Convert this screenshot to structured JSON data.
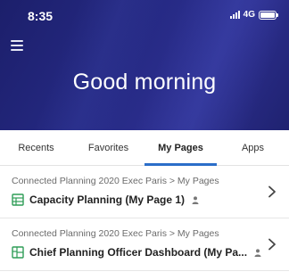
{
  "status_bar": {
    "time": "8:35",
    "network": "4G"
  },
  "header": {
    "greeting": "Good morning"
  },
  "tabs": [
    {
      "label": "Recents",
      "active": false
    },
    {
      "label": "Favorites",
      "active": false
    },
    {
      "label": "My Pages",
      "active": true
    },
    {
      "label": "Apps",
      "active": false
    }
  ],
  "pages": [
    {
      "path": "Connected Planning 2020 Exec Paris > My Pages",
      "title": "Capacity Planning (My Page 1)",
      "icon": "grid-table-icon"
    },
    {
      "path": "Connected Planning 2020 Exec Paris > My Pages",
      "title": "Chief Planning Officer Dashboard (My Pa...",
      "icon": "dashboard-icon"
    }
  ],
  "colors": {
    "header_bg": "#262a85",
    "tab_indicator": "#2b6ec9",
    "icon_green": "#2f9d57"
  }
}
